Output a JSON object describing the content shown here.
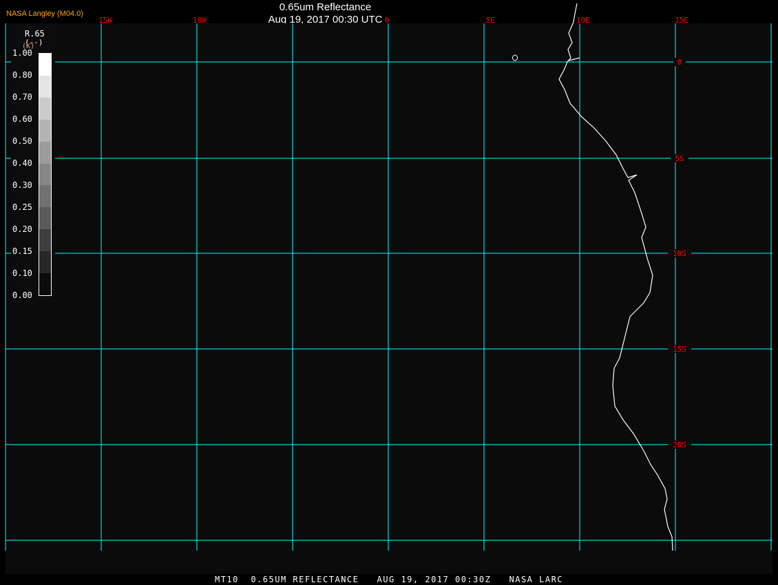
{
  "header": {
    "brand": "NASA Langley (M04.0)",
    "title": "0.65um Reflectance",
    "subtitle": "Aug 19, 2017 00:30 UTC"
  },
  "footer": {
    "text": "MT10  0.65UM REFLECTANCE   AUG 19, 2017 00:30Z   NASA LARC"
  },
  "colorbar": {
    "name": "R.65",
    "units": "(--)",
    "units2": "(K)",
    "labels": [
      "1.00",
      "0.80",
      "0.70",
      "0.60",
      "0.50",
      "0.40",
      "0.30",
      "0.25",
      "0.20",
      "0.15",
      "0.10",
      "0.00"
    ],
    "shades": [
      "#ffffff",
      "#e4e4e4",
      "#cbcbcb",
      "#b4b4b4",
      "#9c9c9c",
      "#878787",
      "#717171",
      "#5a5a5a",
      "#3f3f3f",
      "#272727",
      "#0c0c0c"
    ]
  },
  "map": {
    "lon_labels": [
      "15W",
      "10W",
      "0",
      "5E",
      "10E",
      "15E"
    ],
    "lat_labels": [
      "0",
      "5S",
      "10S",
      "15S",
      "20S"
    ],
    "colors": {
      "grid": "#00ffff",
      "labels": "#ff0000",
      "coast": "#ffffff",
      "background": "#0b0b0b"
    }
  }
}
